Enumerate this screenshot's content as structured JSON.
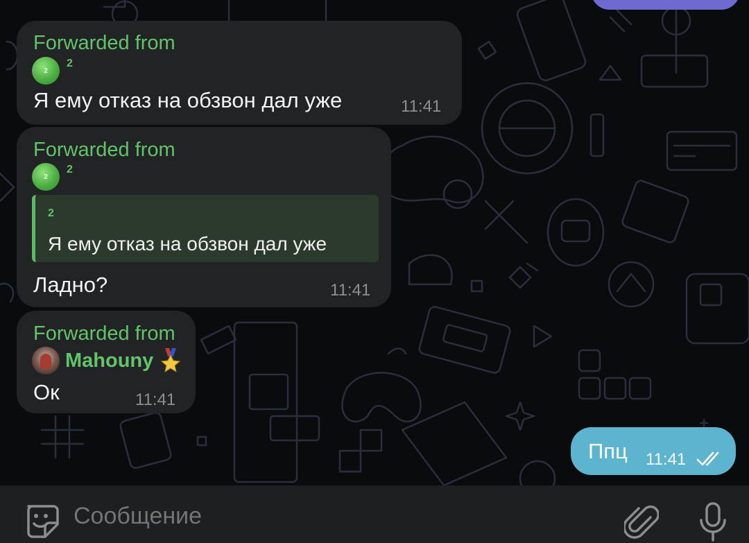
{
  "messages": [
    {
      "forwarded_label": "Forwarded from",
      "source_name": "2",
      "avatar_text": "2",
      "text": "Я ему отказ на обзвон дал уже",
      "time": "11:41"
    },
    {
      "forwarded_label": "Forwarded from",
      "source_name": "2",
      "avatar_text": "2",
      "quote_name": "2",
      "quote_text": "Я ему отказ на обзвон дал уже",
      "text": "Ладно?",
      "time": "11:41"
    },
    {
      "forwarded_label": "Forwarded from",
      "source_name": "Mahouny",
      "text": "Ок",
      "time": "11:41"
    }
  ],
  "outgoing": {
    "text": "Ппц",
    "time": "11:41"
  },
  "input": {
    "placeholder": "Сообщение"
  },
  "icons": {
    "emoji": "sticker-emoji-icon",
    "attach": "paperclip-icon",
    "mic": "microphone-icon",
    "read": "double-check-icon",
    "medal": "medal-icon"
  },
  "colors": {
    "incoming_bubble": "#222325",
    "outgoing_bubble": "#5cb4cf",
    "forward_green": "#63c36a",
    "background": "#0a0b0c",
    "input_bar": "#1e1f21"
  }
}
